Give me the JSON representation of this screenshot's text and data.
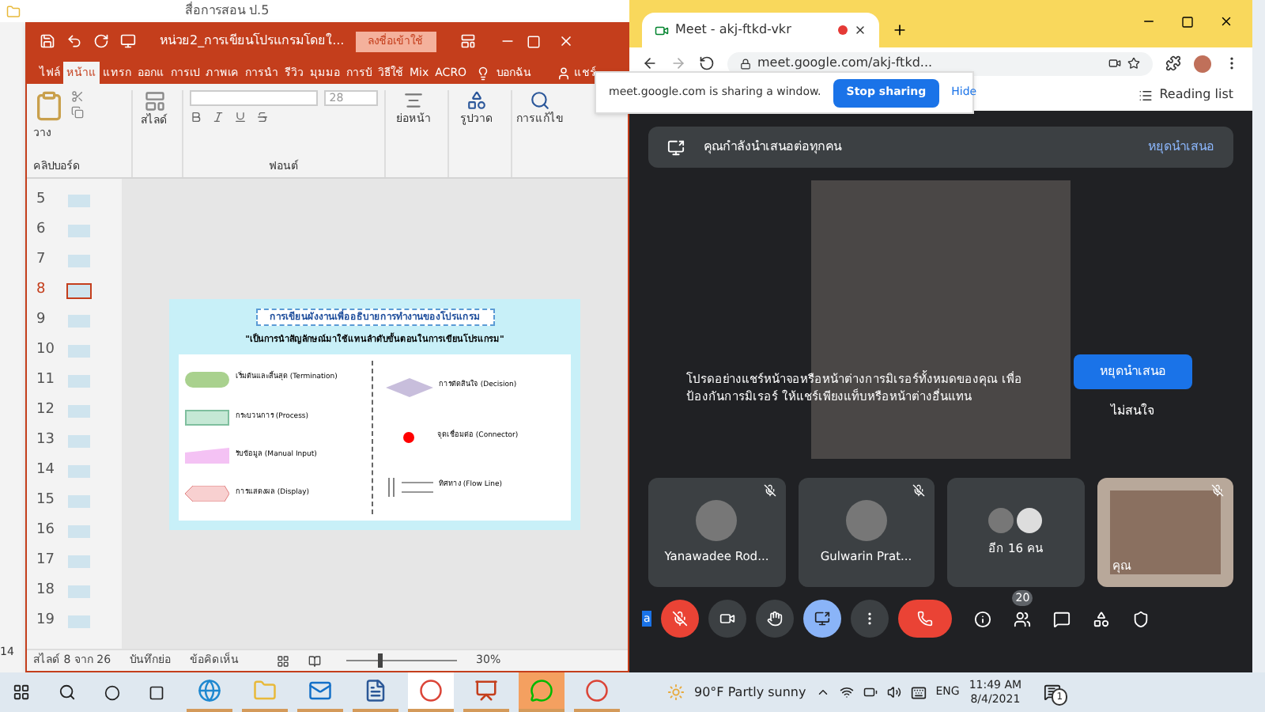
{
  "explorer": {
    "title": "สื่อการสอน ป.5",
    "row_number": "14"
  },
  "powerpoint": {
    "title": "หน่วย2_การเขียนโปรแกรมโดยใ...",
    "sign_in": "ลงชื่อเข้าใช้",
    "tabs": [
      {
        "label": "ไฟล์",
        "selected": false
      },
      {
        "label": "หน้าแ",
        "selected": true
      },
      {
        "label": "แทรก",
        "selected": false
      },
      {
        "label": "ออกแ",
        "selected": false
      },
      {
        "label": "การเป",
        "selected": false
      },
      {
        "label": "ภาพเค",
        "selected": false
      },
      {
        "label": "การนำ",
        "selected": false
      },
      {
        "label": "รีวิว",
        "selected": false
      },
      {
        "label": "มุมมอ",
        "selected": false
      },
      {
        "label": "การบั",
        "selected": false
      },
      {
        "label": "วิธีใช้",
        "selected": false
      },
      {
        "label": "Mix",
        "selected": false
      },
      {
        "label": "ACRO",
        "selected": false
      }
    ],
    "tell_me": "บอกฉัน",
    "share": "แชร์",
    "ribbon": {
      "paste": "วาง",
      "clipboard": "คลิปบอร์ด",
      "slide": "สไลด์",
      "font_size": "28",
      "font_group": "ฟอนต์",
      "paragraph": "ย่อหน้า",
      "drawing": "รูปวาด",
      "editing": "การแก้ไข"
    },
    "thumbnails": [
      {
        "number": "5",
        "selected": false
      },
      {
        "number": "6",
        "selected": false
      },
      {
        "number": "7",
        "selected": false
      },
      {
        "number": "8",
        "selected": true
      },
      {
        "number": "9",
        "selected": false
      },
      {
        "number": "10",
        "selected": false
      },
      {
        "number": "11",
        "selected": false
      },
      {
        "number": "12",
        "selected": false
      },
      {
        "number": "13",
        "selected": false
      },
      {
        "number": "14",
        "selected": false
      },
      {
        "number": "15",
        "selected": false
      },
      {
        "number": "16",
        "selected": false
      },
      {
        "number": "17",
        "selected": false
      },
      {
        "number": "18",
        "selected": false
      },
      {
        "number": "19",
        "selected": false
      }
    ],
    "slide": {
      "title": "การเขียนผังงานเพื่ออธิบายการทำงานของโปรแกรม",
      "subtitle": "\"เป็นการนำสัญลักษณ์มาใช้แทนลำดับขั้นตอนในการเขียนโปรแกรม\"",
      "left_symbols": [
        {
          "kind": "terminator",
          "label": "เริ่มต้นและสิ้นสุด (Termination)"
        },
        {
          "kind": "process",
          "label": "กระบวนการ (Process)"
        },
        {
          "kind": "manual",
          "label": "รับข้อมูล (Manual Input)"
        },
        {
          "kind": "display",
          "label": "การแสดงผล (Display)"
        }
      ],
      "right_symbols": [
        {
          "kind": "decision",
          "label": "การตัดสินใจ (Decision)"
        },
        {
          "kind": "connector",
          "label": "จุดเชื่อมต่อ (Connector)"
        },
        {
          "kind": "flow",
          "label": "ทิศทาง (Flow Line)"
        }
      ]
    },
    "status_bar": {
      "slide_count": "สไลด์ 8 จาก 26",
      "notes": "บันทึกย่อ",
      "comments": "ข้อคิดเห็น",
      "zoom": "30%",
      "zoom_level": {
        "level": 0.3
      }
    }
  },
  "browser": {
    "tab_title": "Meet - akj-ftkd-vkr",
    "url": "meet.google.com/akj-ftkd...",
    "sharing_message": "meet.google.com is sharing a window.",
    "stop_sharing": "Stop sharing",
    "hide": "Hide",
    "reading_list": "Reading list"
  },
  "meet": {
    "banner": "คุณกำลังนำเสนอต่อทุกคน",
    "banner_stop": "หยุดนำเสนอ",
    "warning": "โปรดอย่างแชร์หน้าจอหรือหน้าต่างการมิเรอร์ทั้งหมดของคุณ เพื่อป้องกันการมิเรอร์ ให้แชร์เพียงแท็บหรือหน้าต่างอื่นแทน",
    "stop_button": "หยุดนำเสนอ",
    "dismiss": "ไม่สนใจ",
    "tiles": [
      {
        "kind": "avatar",
        "name": "Yanawadee Rod...",
        "muted": true
      },
      {
        "kind": "avatar",
        "name": "Gulwarin Prat...",
        "muted": true
      },
      {
        "kind": "group",
        "name": "อีก 16 คน",
        "muted": false
      },
      {
        "kind": "video",
        "name": "คุณ",
        "muted": true
      }
    ],
    "caption_label": "a",
    "mic_muted": true,
    "presenting": true,
    "people_count": "20"
  },
  "taskbar": {
    "weather": "90°F Partly sunny",
    "language": "ENG",
    "time": "11:49 AM",
    "date": "8/4/2021",
    "notifications": "1",
    "apps": [
      {
        "kind": "edge",
        "selected": false
      },
      {
        "kind": "explorer",
        "selected": false
      },
      {
        "kind": "mail",
        "selected": false
      },
      {
        "kind": "word",
        "selected": false
      },
      {
        "kind": "chrome",
        "selected": true
      },
      {
        "kind": "powerpoint",
        "selected": false
      },
      {
        "kind": "line",
        "selected": true
      },
      {
        "kind": "chrome",
        "selected": false
      }
    ]
  }
}
